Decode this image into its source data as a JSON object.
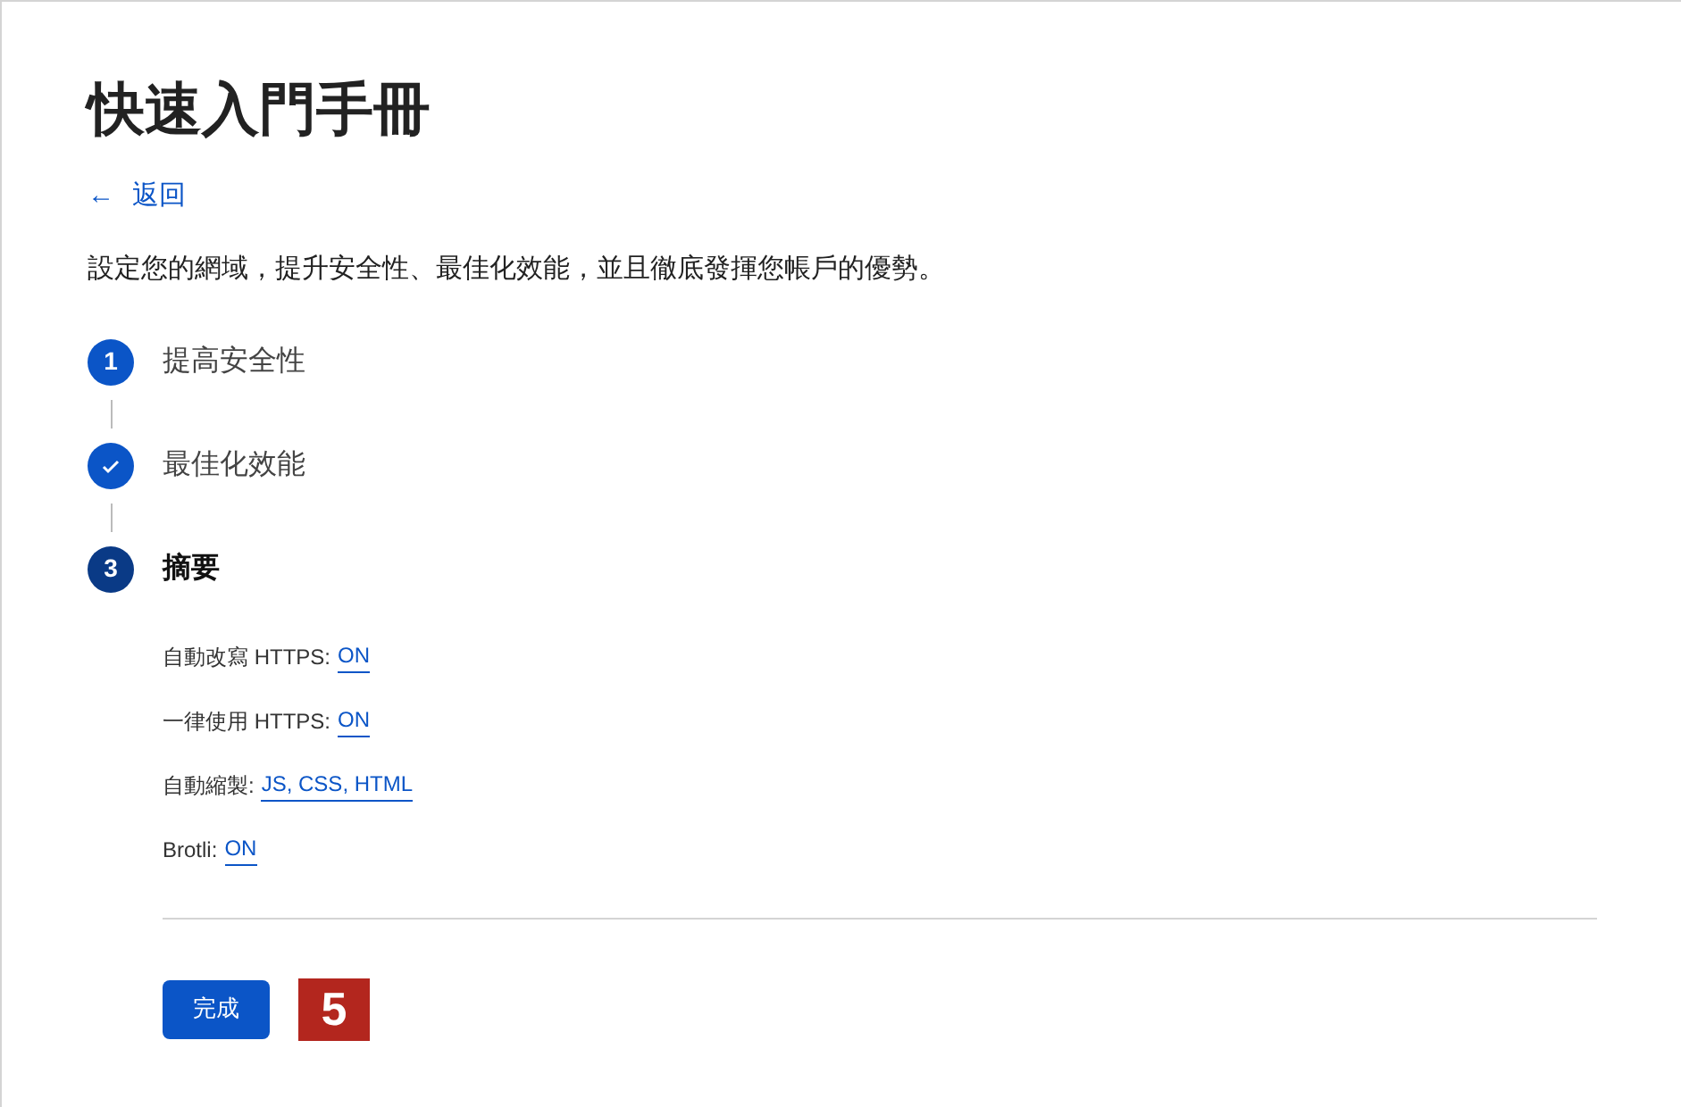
{
  "title": "快速入門手冊",
  "back_link": {
    "icon": "←",
    "label": "返回"
  },
  "description": "設定您的網域，提升安全性、最佳化效能，並且徹底發揮您帳戶的優勢。",
  "steps": [
    {
      "kind": "number",
      "marker": "1",
      "label": "提高安全性",
      "selected": false
    },
    {
      "kind": "check",
      "label": "最佳化效能",
      "selected": false
    },
    {
      "kind": "number",
      "marker": "3",
      "label": "摘要",
      "selected": true
    }
  ],
  "summary": [
    {
      "label": "自動改寫 HTTPS:",
      "value": "ON"
    },
    {
      "label": "一律使用 HTTPS:",
      "value": "ON"
    },
    {
      "label": "自動縮製:",
      "value": "JS, CSS, HTML"
    },
    {
      "label": "Brotli:",
      "value": "ON"
    }
  ],
  "done_button": "完成",
  "callout_badge": "5"
}
